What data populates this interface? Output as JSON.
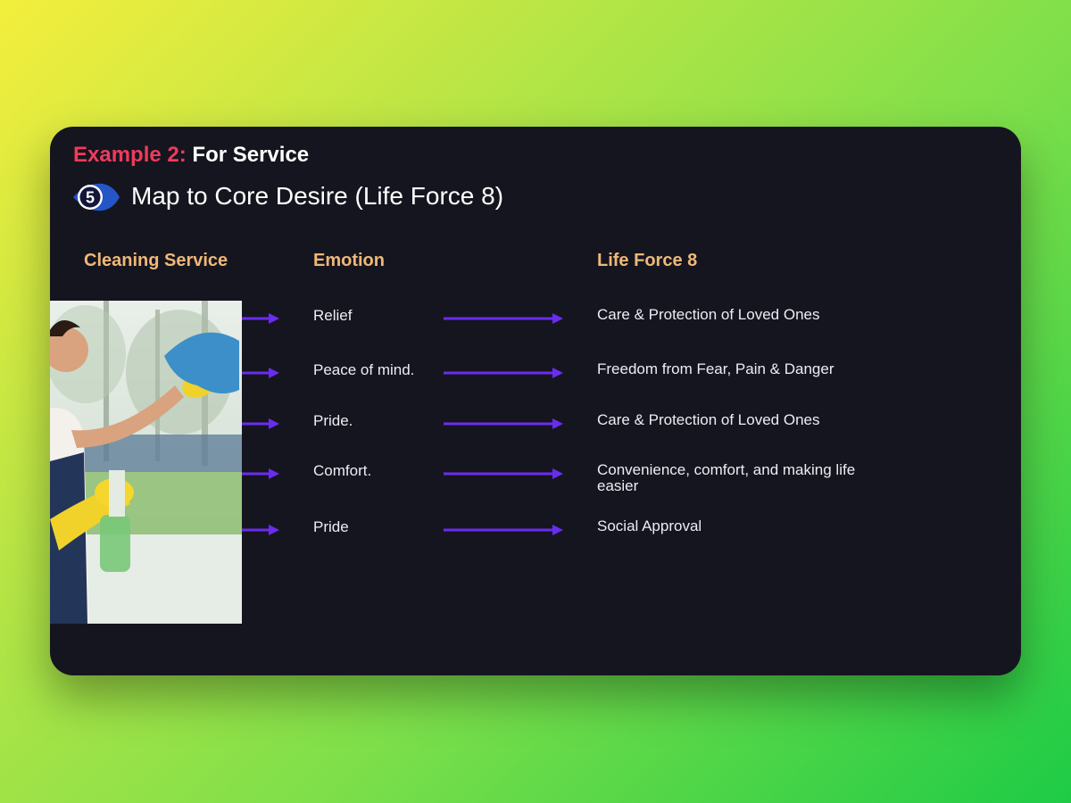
{
  "header": {
    "example_label": "Example 2:",
    "example_topic": "For Service",
    "step_number": "5",
    "step_title": "Map to Core Desire (Life Force 8)"
  },
  "columns": {
    "service": "Cleaning Service",
    "emotion": "Emotion",
    "life_force": "Life Force 8"
  },
  "rows": [
    {
      "emotion": "Relief",
      "life_force": "Care & Protection of Loved Ones"
    },
    {
      "emotion": "Peace of mind.",
      "life_force": "Freedom from Fear, Pain & Danger"
    },
    {
      "emotion": "Pride.",
      "life_force": "Care & Protection of Loved Ones"
    },
    {
      "emotion": "Comfort.",
      "life_force": "Convenience, comfort, and making life easier"
    },
    {
      "emotion": "Pride",
      "life_force": "Social Approval"
    }
  ],
  "colors": {
    "accent_red": "#ef3b5c",
    "header_orange": "#f0b878",
    "arrow_purple": "#6a2cf0",
    "slide_background": "#15151f"
  },
  "icons": {
    "step_badge": "numbered-eye-badge-icon",
    "arrow": "arrow-right-icon"
  }
}
